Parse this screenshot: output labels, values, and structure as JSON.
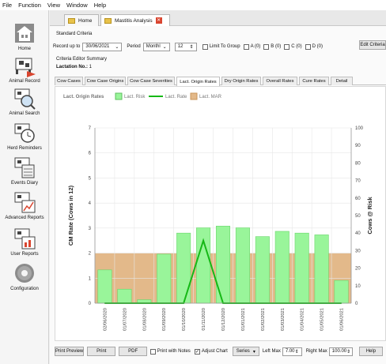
{
  "menu": [
    "File",
    "Function",
    "View",
    "Window",
    "Help"
  ],
  "sidebar": [
    {
      "label": "Home",
      "icon": "house-icon"
    },
    {
      "label": "Animal Record",
      "icon": "cow-record-icon"
    },
    {
      "label": "Animal Search",
      "icon": "cow-search-icon"
    },
    {
      "label": "Herd Reminders",
      "icon": "cow-clock-icon"
    },
    {
      "label": "Events Diary",
      "icon": "cow-diary-icon"
    },
    {
      "label": "Advanced Reports",
      "icon": "cow-chart-icon"
    },
    {
      "label": "User Reports",
      "icon": "cow-report-icon"
    },
    {
      "label": "Configuration",
      "icon": "gear-icon"
    }
  ],
  "tabs": {
    "home": "Home",
    "mastitis": "Mastitis Analysis"
  },
  "criteria": {
    "group_title": "Standard Criteria",
    "record_up_to_label": "Record up to",
    "record_up_to": "30/06/2021",
    "period_label": "Period",
    "period_unit": "Monthl",
    "period_value": "12",
    "limit_label": "Limit To Group",
    "groups": [
      "A (0)",
      "B (0)",
      "C (0)",
      "D (0)"
    ],
    "edit_button": "Edit Criteria"
  },
  "summary": {
    "title": "Criteria Editor Summary",
    "lactation_label": "Lactation No.:",
    "lactation_value": "1"
  },
  "subtabs": [
    "Cow Cases",
    "Cow Case Origins",
    "Cow Case Severities",
    "Lact. Origin Rates",
    "Dry Origin Rates",
    "Overall Rates",
    "Cure Rates",
    "Detail"
  ],
  "active_subtab": 3,
  "chart_data": {
    "type": "bar",
    "legend_title": "Lact. Origin Rates",
    "series_labels": {
      "risk": "Lact. Risk",
      "rate": "Lact. Rate",
      "mar": "Lact. MAR"
    },
    "ylabel": "CM Rate (Cows in 12)",
    "y2label": "Cows @ Risk",
    "ylim": [
      0,
      7
    ],
    "y2lim": [
      0,
      100
    ],
    "yticks": [
      0,
      1,
      2,
      3,
      4,
      5,
      6,
      7
    ],
    "y2ticks": [
      0,
      10,
      20,
      30,
      40,
      50,
      60,
      70,
      80,
      90,
      100
    ],
    "categories": [
      "02/06/2020",
      "01/07/2020",
      "01/08/2020",
      "01/09/2020",
      "01/10/2020",
      "01/11/2020",
      "01/12/2020",
      "01/01/2021",
      "01/02/2021",
      "01/03/2021",
      "01/04/2021",
      "01/05/2021",
      "01/06/2021"
    ],
    "cows_at_risk": [
      19,
      8,
      2,
      28,
      40,
      43,
      44,
      43,
      38,
      41,
      40,
      39,
      13
    ],
    "lact_rate": [
      0,
      0,
      0,
      0,
      0,
      2.5,
      0,
      0,
      0,
      0,
      0,
      0,
      0
    ],
    "lact_mar": 2.0,
    "colors": {
      "risk": "#99f59a",
      "rate": "#16b816",
      "mar": "#e3b98a"
    }
  },
  "bottom": {
    "print_preview": "Print Preview",
    "print": "Print",
    "pdf": "PDF",
    "print_notes": "Print with Notes",
    "adjust_chart": "Adjust Chart",
    "series": "Series",
    "left_max_label": "Left Max",
    "left_max": "7.00",
    "right_max_label": "Right Max",
    "right_max": "100.00",
    "help": "Help"
  }
}
